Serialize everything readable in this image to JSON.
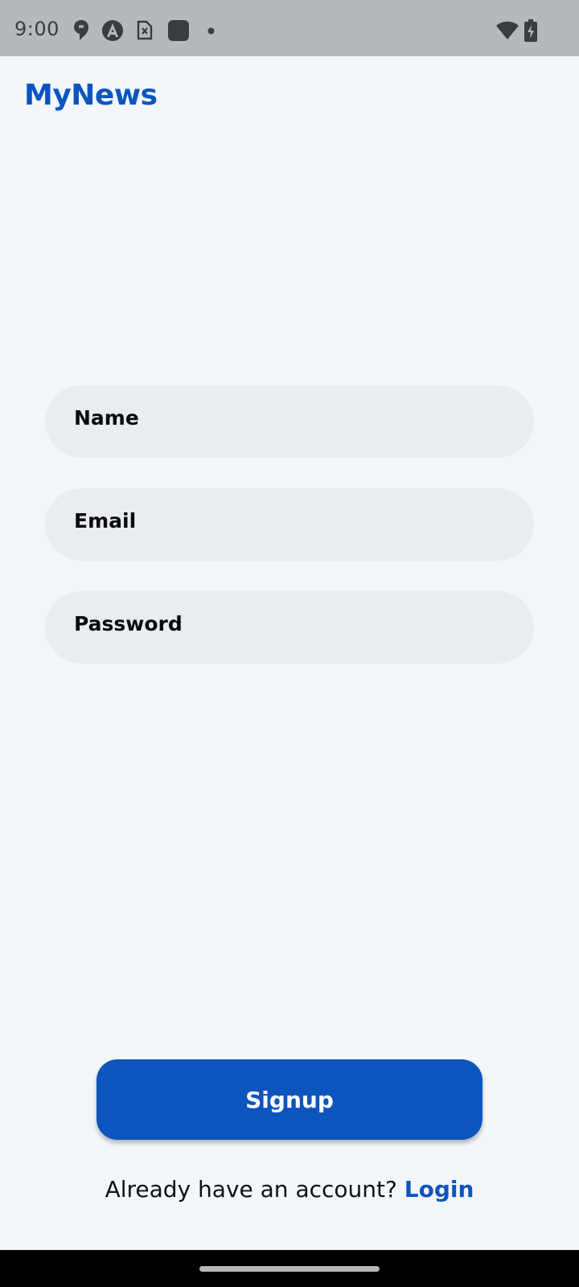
{
  "status_bar": {
    "time": "9:00",
    "icons": [
      "location-pin-icon",
      "accessibility-icon",
      "sim-card-icon",
      "app-square-icon",
      "notification-dot-icon",
      "wifi-icon",
      "battery-charging-icon"
    ]
  },
  "app_bar": {
    "title": "MyNews"
  },
  "form": {
    "name_label": "Name",
    "email_label": "Email",
    "password_label": "Password"
  },
  "actions": {
    "signup_label": "Signup",
    "prompt_text": "Already have an account?",
    "login_label": "Login"
  },
  "colors": {
    "accent": "#0d55be",
    "background": "#f3f7fc",
    "field_background": "#e9ecf1",
    "status_bar": "#b6b9bc"
  }
}
